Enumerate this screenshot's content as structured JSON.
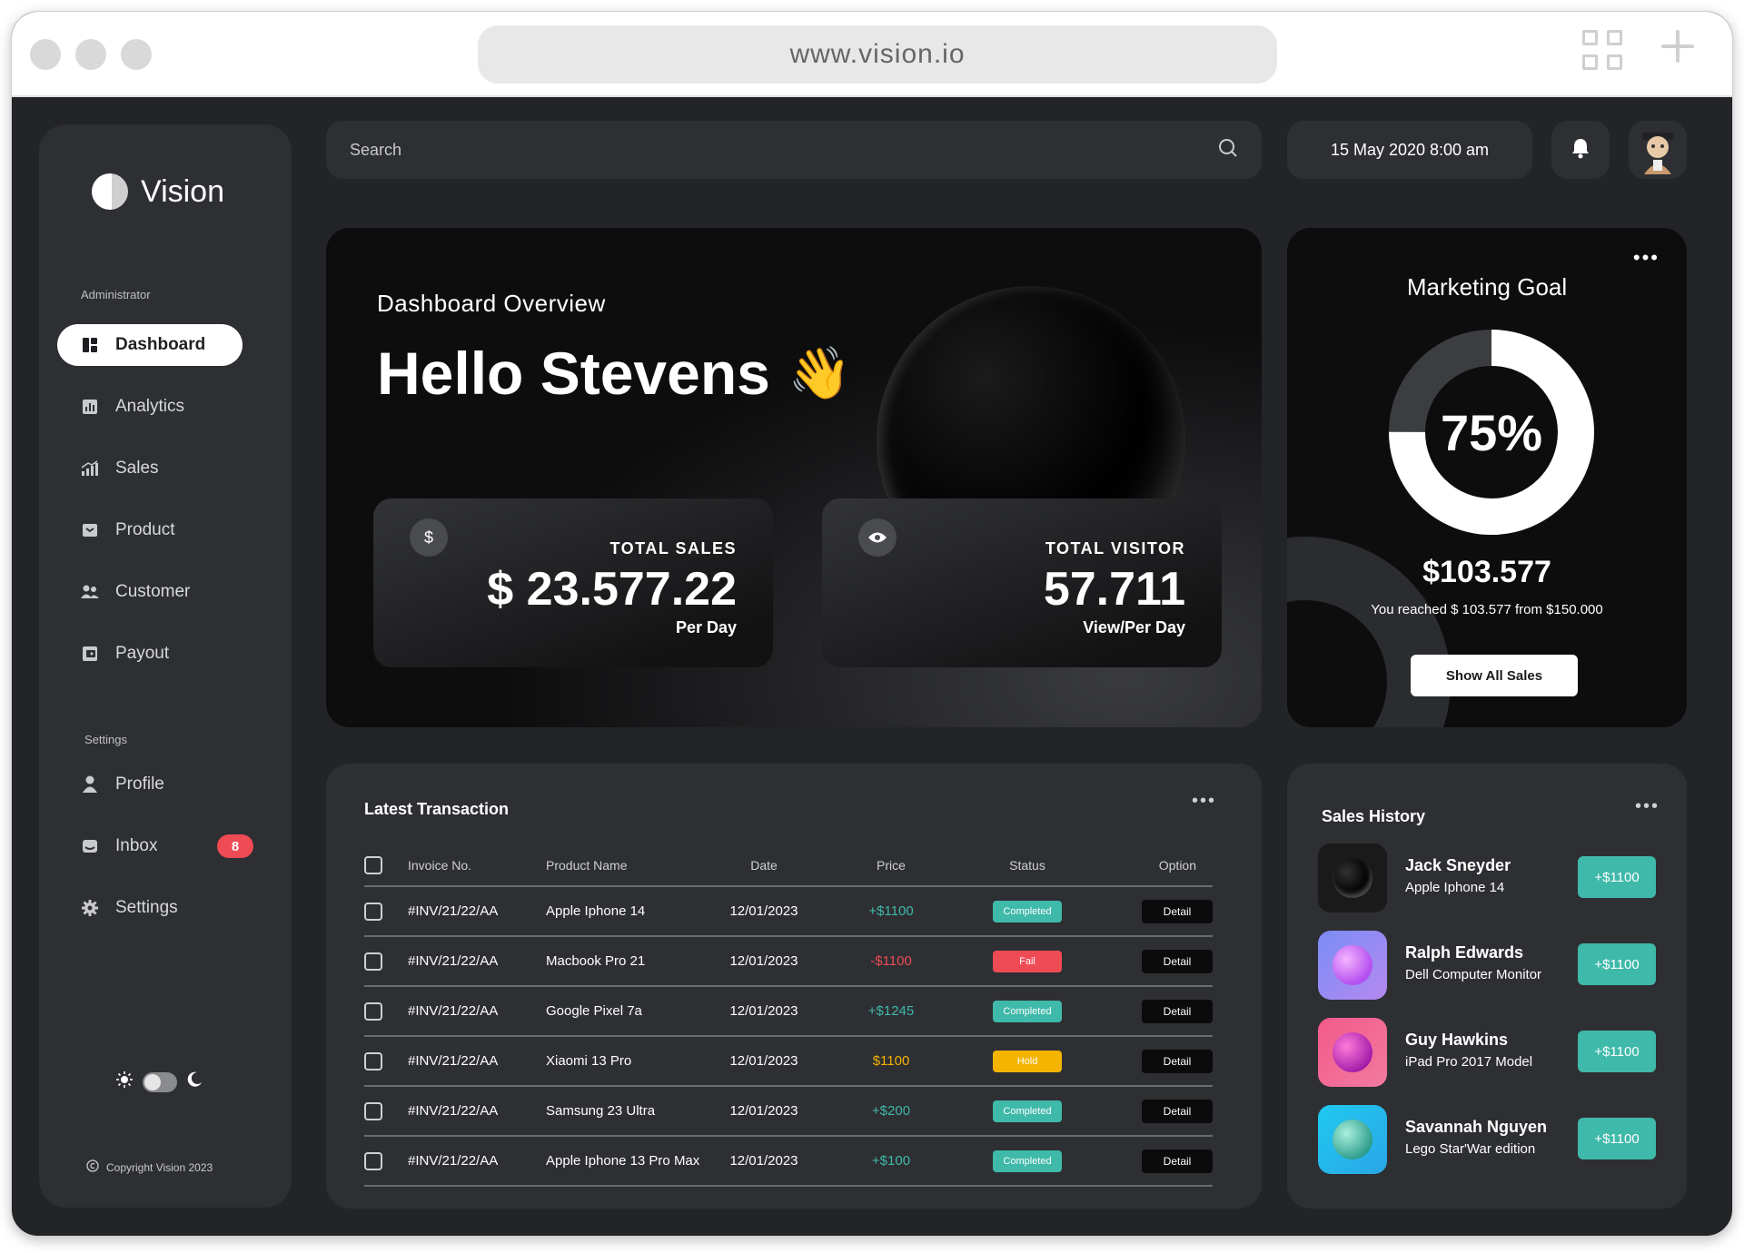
{
  "browser": {
    "url": "www.vision.io"
  },
  "brand": {
    "name": "Vision"
  },
  "sidebar": {
    "admin_label": "Administrator",
    "settings_label": "Settings",
    "items": [
      {
        "label": "Dashboard",
        "icon": "dashboard-icon",
        "active": true
      },
      {
        "label": "Analytics",
        "icon": "analytics-icon"
      },
      {
        "label": "Sales",
        "icon": "sales-icon"
      },
      {
        "label": "Product",
        "icon": "product-icon"
      },
      {
        "label": "Customer",
        "icon": "customer-icon"
      },
      {
        "label": "Payout",
        "icon": "payout-icon"
      }
    ],
    "settings_items": [
      {
        "label": "Profile",
        "icon": "profile-icon"
      },
      {
        "label": "Inbox",
        "icon": "inbox-icon",
        "badge": "8"
      },
      {
        "label": "Settings",
        "icon": "gear-icon"
      }
    ],
    "copyright": "Copyright Vision 2023"
  },
  "topbar": {
    "search_placeholder": "Search",
    "datetime": "15 May 2020 8:00 am"
  },
  "hero": {
    "subtitle": "Dashboard Overview",
    "greeting": "Hello Stevens",
    "greeting_emoji": "👋",
    "cards": [
      {
        "icon_glyph": "$",
        "label": "TOTAL SALES",
        "value": "$ 23.577.22",
        "unit": "Per Day"
      },
      {
        "icon_glyph": "eye",
        "label": "TOTAL VISITOR",
        "value": "57.711",
        "unit": "View/Per Day"
      }
    ]
  },
  "goal": {
    "title": "Marketing Goal",
    "percent_label": "75%",
    "percent_value": 75,
    "amount": "$103.577",
    "note": "You reached $ 103.577 from $150.000",
    "button": "Show All Sales"
  },
  "transactions": {
    "title": "Latest Transaction",
    "columns": [
      "Invoice No.",
      "Product Name",
      "Date",
      "Price",
      "Status",
      "Option"
    ],
    "rows": [
      {
        "invoice": "#INV/21/22/AA",
        "product": "Apple Iphone 14",
        "date": "12/01/2023",
        "price": "+$1100",
        "status": "Completed",
        "option": "Detail"
      },
      {
        "invoice": "#INV/21/22/AA",
        "product": "Macbook Pro 21",
        "date": "12/01/2023",
        "price": "-$1100",
        "status": "Fail",
        "option": "Detail"
      },
      {
        "invoice": "#INV/21/22/AA",
        "product": "Google Pixel 7a",
        "date": "12/01/2023",
        "price": "+$1245",
        "status": "Completed",
        "option": "Detail"
      },
      {
        "invoice": "#INV/21/22/AA",
        "product": "Xiaomi 13 Pro",
        "date": "12/01/2023",
        "price": "$1100",
        "status": "Hold",
        "option": "Detail"
      },
      {
        "invoice": "#INV/21/22/AA",
        "product": "Samsung 23 Ultra",
        "date": "12/01/2023",
        "price": "+$200",
        "status": "Completed",
        "option": "Detail"
      },
      {
        "invoice": "#INV/21/22/AA",
        "product": "Apple Iphone 13 Pro Max",
        "date": "12/01/2023",
        "price": "+$100",
        "status": "Completed",
        "option": "Detail"
      }
    ]
  },
  "history": {
    "title": "Sales History",
    "items": [
      {
        "name": "Jack Sneyder",
        "product": "Apple Iphone 14",
        "amount": "+$1100"
      },
      {
        "name": "Ralph Edwards",
        "product": "Dell Computer Monitor",
        "amount": "+$1100"
      },
      {
        "name": "Guy Hawkins",
        "product": "iPad Pro 2017 Model",
        "amount": "+$1100"
      },
      {
        "name": "Savannah Nguyen",
        "product": "Lego Star'War edition",
        "amount": "+$1100"
      }
    ]
  },
  "colors": {
    "positive": "#3fb9a9",
    "negative": "#ef4b55",
    "hold": "#f4b400",
    "panel": "#2e2f33",
    "background": "#232427"
  }
}
